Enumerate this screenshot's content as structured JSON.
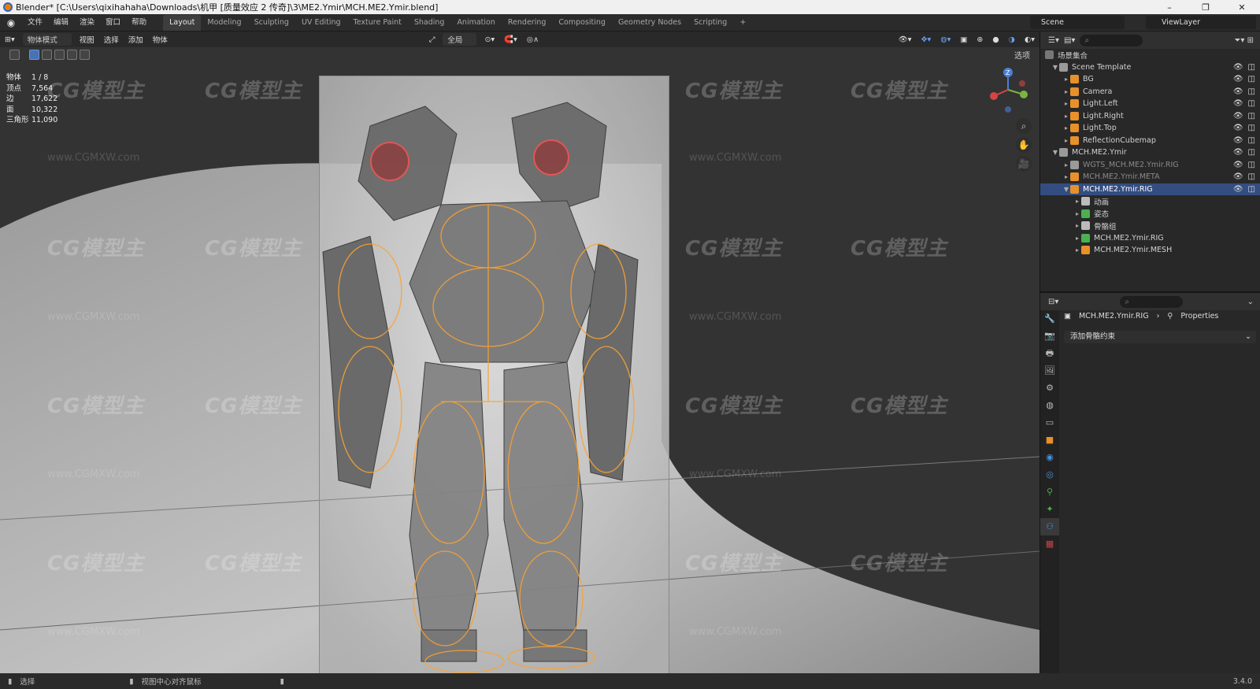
{
  "window": {
    "title": "Blender* [C:\\Users\\qixihahaha\\Downloads\\机甲 [质量效应 2 传奇]\\3\\ME2.Ymir\\MCH.ME2.Ymir.blend]",
    "minimize": "–",
    "restore": "❐",
    "close": "✕"
  },
  "menu": {
    "items": [
      "文件",
      "编辑",
      "渲染",
      "窗口",
      "帮助"
    ],
    "workspaces": [
      "Layout",
      "Modeling",
      "Sculpting",
      "UV Editing",
      "Texture Paint",
      "Shading",
      "Animation",
      "Rendering",
      "Compositing",
      "Geometry Nodes",
      "Scripting"
    ],
    "active_workspace": "Layout",
    "add_tab": "+",
    "scene": "Scene",
    "view_layer": "ViewLayer"
  },
  "viewport_header": {
    "mode": "物体模式",
    "menus": [
      "视图",
      "选择",
      "添加",
      "物体"
    ],
    "transform_orientation": "全局",
    "options": "选项"
  },
  "stats": [
    {
      "label": "物体",
      "value": "1 / 8"
    },
    {
      "label": "顶点",
      "value": "7,564"
    },
    {
      "label": "边",
      "value": "17,622"
    },
    {
      "label": "面",
      "value": "10,322"
    },
    {
      "label": "三角形",
      "value": "11,090"
    }
  ],
  "gizmo": {
    "z": "Z"
  },
  "watermark": {
    "text": "CG模型主",
    "url": "www.CGMXW.com"
  },
  "outliner": {
    "title": "场景集合",
    "rows": [
      {
        "name": "Scene Template",
        "indent": 1,
        "icon": "collection-icon",
        "expanded": true,
        "state": "normal"
      },
      {
        "name": "BG",
        "indent": 2,
        "icon": "object-icon",
        "state": "normal"
      },
      {
        "name": "Camera",
        "indent": 2,
        "icon": "camera-icon",
        "state": "normal"
      },
      {
        "name": "Light.Left",
        "indent": 2,
        "icon": "light-icon",
        "state": "normal"
      },
      {
        "name": "Light.Right",
        "indent": 2,
        "icon": "light-icon",
        "state": "normal"
      },
      {
        "name": "Light.Top",
        "indent": 2,
        "icon": "light-icon",
        "state": "normal"
      },
      {
        "name": "ReflectionCubemap",
        "indent": 2,
        "icon": "probe-icon",
        "state": "normal"
      },
      {
        "name": "MCH.ME2.Ymir",
        "indent": 1,
        "icon": "collection-icon",
        "expanded": true,
        "state": "normal"
      },
      {
        "name": "WGTS_MCH.ME2.Ymir.RIG",
        "indent": 2,
        "icon": "collection-icon",
        "state": "dim"
      },
      {
        "name": "MCH.ME2.Ymir.META",
        "indent": 2,
        "icon": "armature-icon",
        "state": "dim"
      },
      {
        "name": "MCH.ME2.Ymir.RIG",
        "indent": 2,
        "icon": "armature-icon",
        "expanded": true,
        "state": "selected"
      },
      {
        "name": "动画",
        "indent": 3,
        "icon": "action-icon",
        "state": "normal"
      },
      {
        "name": "姿态",
        "indent": 3,
        "icon": "pose-icon",
        "state": "normal"
      },
      {
        "name": "骨骼组",
        "indent": 3,
        "icon": "bone-group-icon",
        "state": "normal"
      },
      {
        "name": "MCH.ME2.Ymir.RIG",
        "indent": 3,
        "icon": "armature-data-icon",
        "state": "normal"
      },
      {
        "name": "MCH.ME2.Ymir.MESH",
        "indent": 3,
        "icon": "mesh-icon",
        "state": "normal"
      }
    ]
  },
  "properties": {
    "object": "MCH.ME2.Ymir.RIG",
    "section": "Properties",
    "add_constraint": "添加骨骼约束"
  },
  "statusbar": {
    "select": "选择",
    "center_view": "视图中心对齐鼠标",
    "version": "3.4.0"
  }
}
